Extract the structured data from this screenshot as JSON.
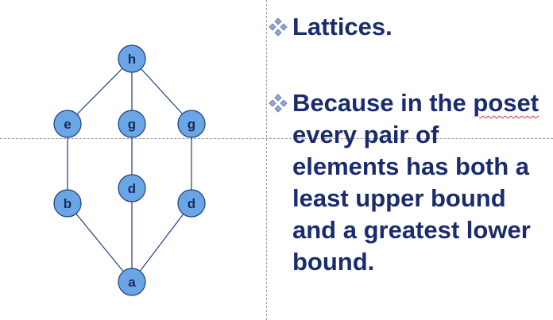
{
  "diagram": {
    "nodes": [
      {
        "id": "h",
        "label": "h"
      },
      {
        "id": "e",
        "label": "e"
      },
      {
        "id": "g1",
        "label": "g"
      },
      {
        "id": "g2",
        "label": "g"
      },
      {
        "id": "d1",
        "label": "d"
      },
      {
        "id": "b",
        "label": "b"
      },
      {
        "id": "d2",
        "label": "d"
      },
      {
        "id": "a",
        "label": "a"
      }
    ],
    "edges": [
      [
        "h",
        "e"
      ],
      [
        "h",
        "g1"
      ],
      [
        "h",
        "g2"
      ],
      [
        "e",
        "b"
      ],
      [
        "g1",
        "d1"
      ],
      [
        "g2",
        "d2"
      ],
      [
        "b",
        "a"
      ],
      [
        "d1",
        "a"
      ],
      [
        "d2",
        "a"
      ]
    ],
    "colors": {
      "node_fill": "#6aa5e6",
      "node_stroke": "#1f3f7a",
      "label": "#1a2a5a"
    }
  },
  "text_panel": {
    "bullet_icon": "diamond-cluster-icon",
    "bullet1": "Lattices.",
    "bullet2_lead": "Because in the ",
    "bullet2_flagged": "poset",
    "bullet2_rest": " every pair of elements has both a least upper bound and a greatest lower bound.",
    "text_color": "#1a2b6e"
  }
}
